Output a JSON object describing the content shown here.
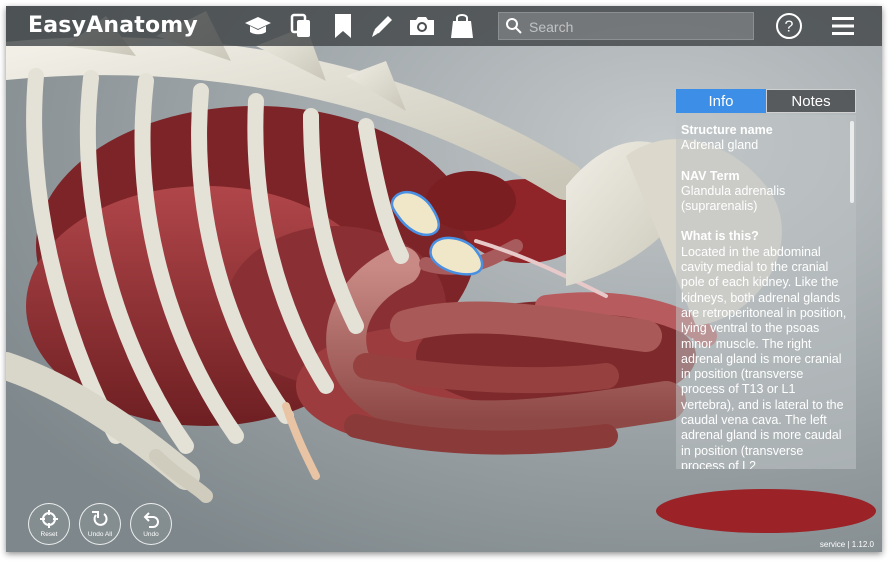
{
  "app": {
    "title": "EasyAnatomy",
    "version": "service | 1.12.0"
  },
  "toolbar": {
    "icons": [
      "graduation-cap-icon",
      "copy-icon",
      "bookmark-icon",
      "pencil-icon",
      "camera-icon",
      "shopping-bag-icon"
    ],
    "help_icon": "help-icon",
    "menu_icon": "menu-icon"
  },
  "search": {
    "placeholder": "Search",
    "value": ""
  },
  "panel": {
    "tabs": [
      {
        "label": "Info",
        "active": true
      },
      {
        "label": "Notes",
        "active": false
      }
    ],
    "sections": [
      {
        "heading": "Structure name",
        "text": "Adrenal gland"
      },
      {
        "heading": "NAV Term",
        "text": "Glandula adrenalis (suprarenalis)"
      },
      {
        "heading": "What is this?",
        "text": "Located in the abdominal cavity medial to the cranial pole of each kidney. Like the kidneys, both adrenal glands are retroperitoneal in position, lying ventral to the psoas minor muscle. The right adrenal gland is more cranial in position (transverse process of T13 or L1 vertebra), and is lateral to the caudal vena cava. The left adrenal gland is more caudal in position (transverse process of L2"
      }
    ]
  },
  "controls": [
    {
      "label": "Reset",
      "icon": "crosshair-icon"
    },
    {
      "label": "Undo All",
      "icon": "undo-all-icon"
    },
    {
      "label": "Undo",
      "icon": "undo-icon"
    }
  ],
  "colors": {
    "active_tab": "#3d8ee6",
    "highlight": "#4a90e2"
  }
}
